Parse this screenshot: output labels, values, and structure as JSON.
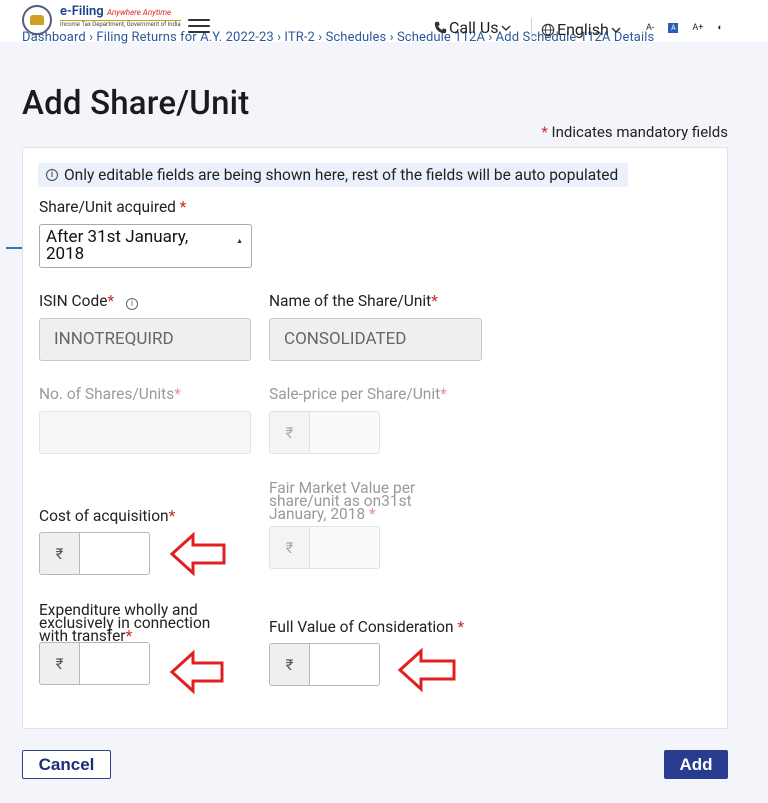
{
  "header": {
    "logo_main": "e-Filing",
    "logo_tagline": "Anywhere Anytime",
    "logo_sub": "Income Tax Department, Government of India",
    "breadcrumb": "Dashboard › Filing Returns for A.Y. 2022-23 › ITR-2 › Schedules › Schedule 112A › Add Schedule 112A Details",
    "call_us": "Call Us",
    "language": "English",
    "font_decrease": "A-",
    "font_normal": "A",
    "font_increase": "A+",
    "contrast": "◐"
  },
  "page": {
    "title": "Add Share/Unit",
    "mandatory_note": "Indicates mandatory fields",
    "required_mark": "*"
  },
  "form": {
    "info_text": "Only editable fields are being shown here, rest of the fields will be auto populated",
    "share_acquired_label": "Share/Unit acquired",
    "share_acquired_value": "After 31st January, 2018",
    "isin_label": "ISIN Code",
    "isin_value": "INNOTREQUIRD",
    "name_label": "Name of the Share/Unit",
    "name_value": "CONSOLIDATED",
    "num_shares_label": "No. of Shares/Units",
    "sale_price_label": "Sale-price per Share/Unit",
    "fmv_label": "Fair Market Value per share/unit as on31st January, 2018",
    "cost_label": "Cost of acquisition",
    "expenditure_label": "Expenditure wholly and exclusively in connection with transfer",
    "full_value_label": "Full Value of Consideration",
    "currency_symbol": "₹"
  },
  "actions": {
    "cancel": "Cancel",
    "add": "Add"
  },
  "colors": {
    "primary": "#283d8f",
    "required": "#c92a2a",
    "annotation_arrow": "#e02020",
    "info_bg": "#eaf1fb"
  }
}
